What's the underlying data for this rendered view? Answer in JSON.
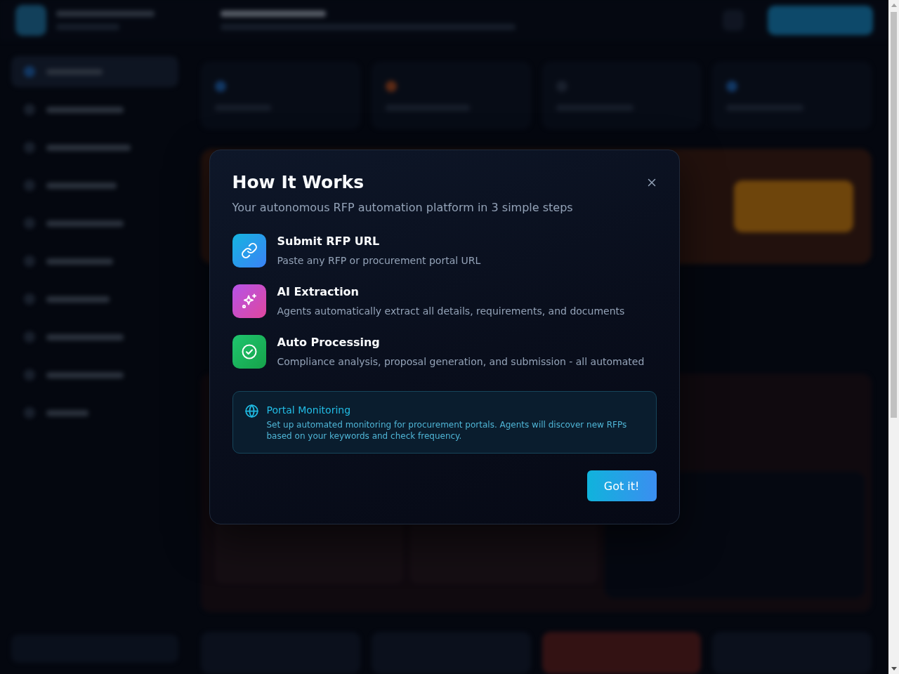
{
  "dialog": {
    "title": "How It Works",
    "subtitle": "Your autonomous RFP automation platform in 3 simple steps",
    "steps": [
      {
        "kind": "link",
        "title": "Submit RFP URL",
        "description": "Paste any RFP or procurement portal URL"
      },
      {
        "kind": "sparkle",
        "title": "AI Extraction",
        "description": "Agents automatically extract all details, requirements, and documents"
      },
      {
        "kind": "check",
        "title": "Auto Processing",
        "description": "Compliance analysis, proposal generation, and submission - all automated"
      }
    ],
    "info": {
      "title": "Portal Monitoring",
      "text": "Set up automated monitoring for procurement portals. Agents will discover new RFPs based on your keywords and check frequency."
    },
    "button": "Got it!"
  }
}
